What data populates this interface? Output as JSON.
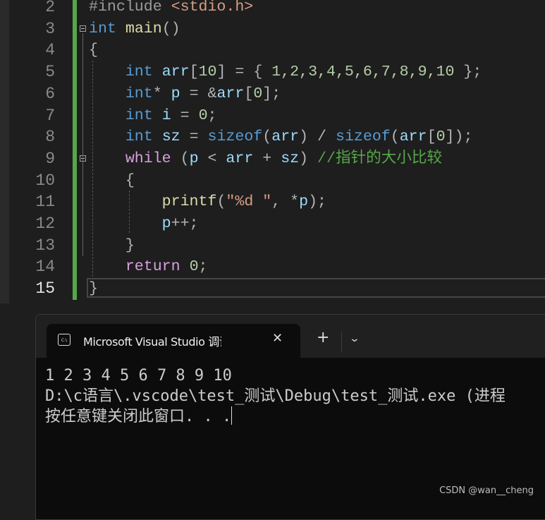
{
  "editor": {
    "current_line": 15,
    "lines": [
      {
        "n": "2",
        "tokens": [
          {
            "t": "#include ",
            "c": "pp"
          },
          {
            "t": "<stdio.h>",
            "c": "str"
          }
        ]
      },
      {
        "n": "3",
        "tokens": [
          {
            "t": "int",
            "c": "kw"
          },
          {
            "t": " ",
            "c": ""
          },
          {
            "t": "main",
            "c": "fn"
          },
          {
            "t": "()",
            "c": "pu"
          }
        ]
      },
      {
        "n": "4",
        "tokens": [
          {
            "t": "{",
            "c": "pu"
          }
        ]
      },
      {
        "n": "5",
        "tokens": [
          {
            "t": "    ",
            "c": ""
          },
          {
            "t": "int",
            "c": "kw"
          },
          {
            "t": " ",
            "c": ""
          },
          {
            "t": "arr",
            "c": "id"
          },
          {
            "t": "[",
            "c": "pu"
          },
          {
            "t": "10",
            "c": "num"
          },
          {
            "t": "] = { ",
            "c": "pu"
          },
          {
            "t": "1,2,3,4,5,6,7,8,9,10",
            "c": "num"
          },
          {
            "t": " };",
            "c": "pu"
          }
        ]
      },
      {
        "n": "6",
        "tokens": [
          {
            "t": "    ",
            "c": ""
          },
          {
            "t": "int",
            "c": "kw"
          },
          {
            "t": "* ",
            "c": "pu"
          },
          {
            "t": "p",
            "c": "id"
          },
          {
            "t": " = &",
            "c": "pu"
          },
          {
            "t": "arr",
            "c": "id"
          },
          {
            "t": "[",
            "c": "pu"
          },
          {
            "t": "0",
            "c": "num"
          },
          {
            "t": "];",
            "c": "pu"
          }
        ]
      },
      {
        "n": "7",
        "tokens": [
          {
            "t": "    ",
            "c": ""
          },
          {
            "t": "int",
            "c": "kw"
          },
          {
            "t": " ",
            "c": ""
          },
          {
            "t": "i",
            "c": "id"
          },
          {
            "t": " = ",
            "c": "pu"
          },
          {
            "t": "0",
            "c": "num"
          },
          {
            "t": ";",
            "c": "pu"
          }
        ]
      },
      {
        "n": "8",
        "tokens": [
          {
            "t": "    ",
            "c": ""
          },
          {
            "t": "int",
            "c": "kw"
          },
          {
            "t": " ",
            "c": ""
          },
          {
            "t": "sz",
            "c": "id"
          },
          {
            "t": " = ",
            "c": "pu"
          },
          {
            "t": "sizeof",
            "c": "kw"
          },
          {
            "t": "(",
            "c": "pu"
          },
          {
            "t": "arr",
            "c": "id"
          },
          {
            "t": ") / ",
            "c": "pu"
          },
          {
            "t": "sizeof",
            "c": "kw"
          },
          {
            "t": "(",
            "c": "pu"
          },
          {
            "t": "arr",
            "c": "id"
          },
          {
            "t": "[",
            "c": "pu"
          },
          {
            "t": "0",
            "c": "num"
          },
          {
            "t": "]);",
            "c": "pu"
          }
        ]
      },
      {
        "n": "9",
        "tokens": [
          {
            "t": "    ",
            "c": ""
          },
          {
            "t": "while",
            "c": "ctl"
          },
          {
            "t": " (",
            "c": "pu"
          },
          {
            "t": "p",
            "c": "id"
          },
          {
            "t": " < ",
            "c": "pu"
          },
          {
            "t": "arr",
            "c": "id"
          },
          {
            "t": " + ",
            "c": "pu"
          },
          {
            "t": "sz",
            "c": "id"
          },
          {
            "t": ") ",
            "c": "pu"
          },
          {
            "t": "//指针的大小比较",
            "c": "cm"
          }
        ]
      },
      {
        "n": "10",
        "tokens": [
          {
            "t": "    {",
            "c": "pu"
          }
        ]
      },
      {
        "n": "11",
        "tokens": [
          {
            "t": "        ",
            "c": ""
          },
          {
            "t": "printf",
            "c": "fn"
          },
          {
            "t": "(",
            "c": "pu"
          },
          {
            "t": "\"%d \"",
            "c": "str"
          },
          {
            "t": ", *",
            "c": "pu"
          },
          {
            "t": "p",
            "c": "id"
          },
          {
            "t": ");",
            "c": "pu"
          }
        ]
      },
      {
        "n": "12",
        "tokens": [
          {
            "t": "        ",
            "c": ""
          },
          {
            "t": "p",
            "c": "id"
          },
          {
            "t": "++;",
            "c": "pu"
          }
        ]
      },
      {
        "n": "13",
        "tokens": [
          {
            "t": "    }",
            "c": "pu"
          }
        ]
      },
      {
        "n": "14",
        "tokens": [
          {
            "t": "    ",
            "c": ""
          },
          {
            "t": "return",
            "c": "ctl"
          },
          {
            "t": " ",
            "c": ""
          },
          {
            "t": "0",
            "c": "num"
          },
          {
            "t": ";",
            "c": "pu"
          }
        ]
      },
      {
        "n": "15",
        "tokens": [
          {
            "t": "}",
            "c": "pu"
          }
        ]
      }
    ]
  },
  "terminal": {
    "tab_title": "Microsoft Visual Studio 调试控制台",
    "tab_icon": "console-icon",
    "icon_text": "C:\\",
    "close_label": "✕",
    "new_tab_label": "+",
    "dropdown_label": "⌄",
    "output": [
      "1 2 3 4 5 6 7 8 9 10",
      "D:\\c语言\\.vscode\\test_测试\\Debug\\test_测试.exe (进程",
      "按任意键关闭此窗口. . ."
    ]
  },
  "watermark": "CSDN @wan__cheng"
}
